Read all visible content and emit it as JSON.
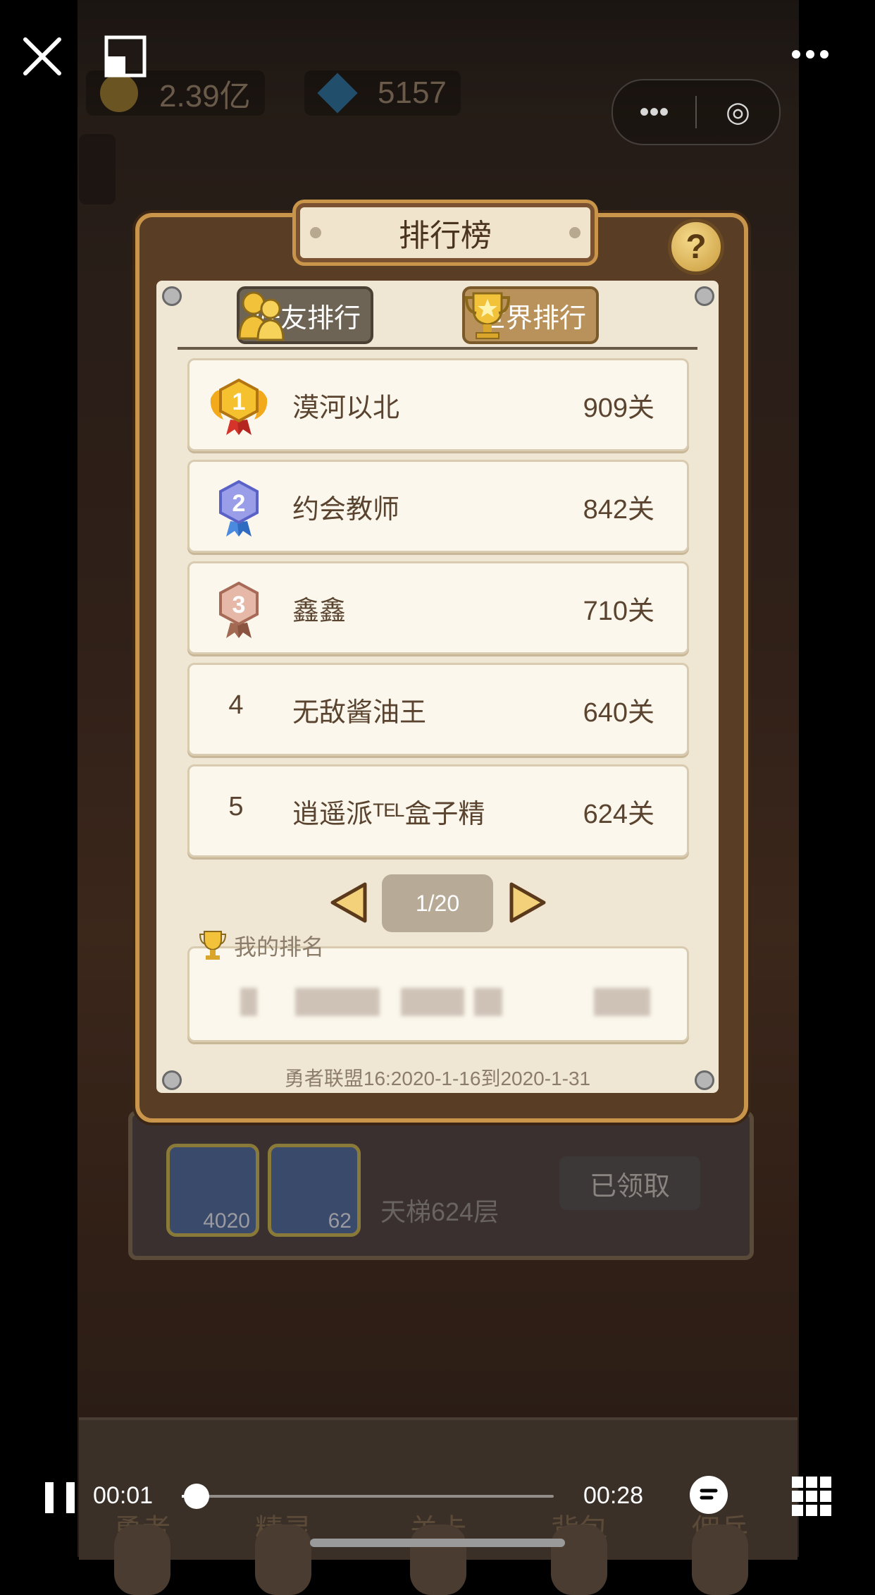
{
  "top_bar": {
    "close_icon": "close-icon",
    "minimize_icon": "floating-window-icon",
    "more_icon": "more-icon"
  },
  "game_hud": {
    "gold": "2.39亿",
    "gems": "5157"
  },
  "capsule": {
    "more_glyph": "•••",
    "target_glyph": "◎"
  },
  "leaderboard": {
    "title": "排行榜",
    "help_glyph": "?",
    "tabs": [
      {
        "label": "好友排行"
      },
      {
        "label": "世界排行"
      }
    ],
    "rows": [
      {
        "rank": "1",
        "name": "漠河以北",
        "score": "909关"
      },
      {
        "rank": "2",
        "name": "约会教师",
        "score": "842关"
      },
      {
        "rank": "3",
        "name": "鑫鑫",
        "score": "710关"
      },
      {
        "rank": "4",
        "name": "无敌酱油王",
        "score": "640关"
      },
      {
        "rank": "5",
        "name": "逍遥派ᵀᴱᴸ盒子精",
        "score": "624关"
      }
    ],
    "pager": "1/20",
    "my_rank_title": "我的排名",
    "season": "勇者联盟16:2020-1-16到2020-1-31"
  },
  "background_panel": {
    "reward_1": "4020",
    "reward_2": "62",
    "ladder": "天梯624层",
    "claimed": "已领取"
  },
  "bottom_nav": [
    {
      "label": "勇者"
    },
    {
      "label": "精灵"
    },
    {
      "label": "关卡"
    },
    {
      "label": "背包"
    },
    {
      "label": "佣兵"
    }
  ],
  "player": {
    "current_time": "00:01",
    "total_time": "00:28",
    "progress": 0.04
  }
}
